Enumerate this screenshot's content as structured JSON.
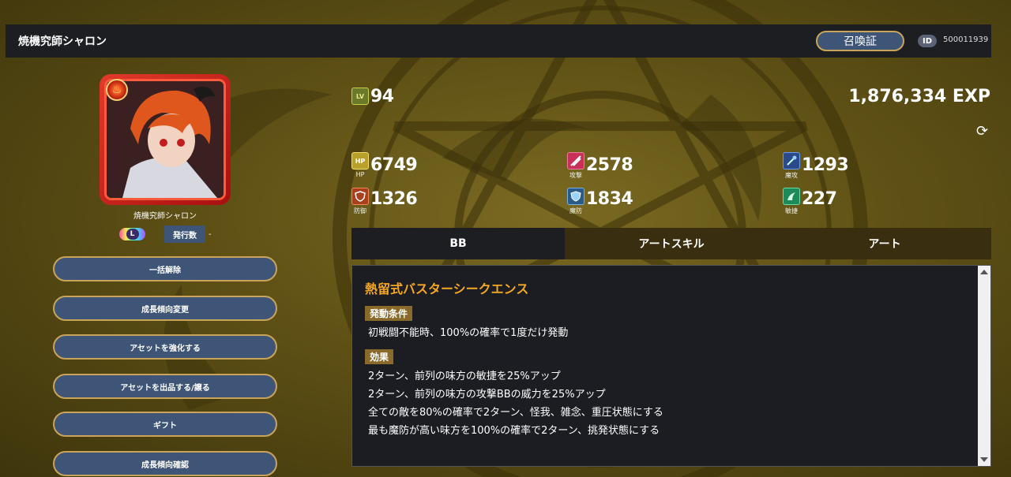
{
  "header": {
    "title": "焼機究師シャロン",
    "summon_label": "召喚証",
    "id_label": "ID",
    "id_value": "500011939"
  },
  "unit": {
    "name": "焼機究師シャロン",
    "element_icon": "fire-icon",
    "rarity": "L",
    "issue_label": "発行数",
    "issue_value": "-"
  },
  "actions": [
    {
      "label": "一括解除"
    },
    {
      "label": "成長傾向変更"
    },
    {
      "label": "アセットを強化する"
    },
    {
      "label": "アセットを出品する/譲る"
    },
    {
      "label": "ギフト"
    },
    {
      "label": "成長傾向確認"
    }
  ],
  "level": {
    "icon": "LV",
    "value": "94"
  },
  "exp": "1,876,334 EXP",
  "stats": {
    "hp": {
      "icon": "HP",
      "label": "HP",
      "value": "6749",
      "color": "#b8a02a"
    },
    "atk": {
      "icon": "",
      "label": "攻撃",
      "value": "2578",
      "color": "#c8305a"
    },
    "matk": {
      "icon": "",
      "label": "魔攻",
      "value": "1293",
      "color": "#2a6ab8"
    },
    "def": {
      "icon": "",
      "label": "防御",
      "value": "1326",
      "color": "#c8502a"
    },
    "mdef": {
      "icon": "",
      "label": "魔防",
      "value": "1834",
      "color": "#2a7ab8"
    },
    "agi": {
      "icon": "",
      "label": "敏捷",
      "value": "227",
      "color": "#2aa86a"
    }
  },
  "tabs": [
    {
      "label": "BB",
      "active": true
    },
    {
      "label": "アートスキル",
      "active": false
    },
    {
      "label": "アート",
      "active": false
    }
  ],
  "skill": {
    "name": "熱留式バスターシークエンス",
    "condition_label": "発動条件",
    "condition": "初戦闘不能時、100%の確率で1度だけ発動",
    "effect_label": "効果",
    "effects": [
      "2ターン、前列の味方の敏捷を25%アップ",
      "2ターン、前列の味方の攻撃BBの威力を25%アップ",
      "全ての敵を80%の確率で2ターン、怪我、雑念、重圧状態にする",
      "最も魔防が高い味方を100%の確率で2ターン、挑発状態にする"
    ]
  }
}
